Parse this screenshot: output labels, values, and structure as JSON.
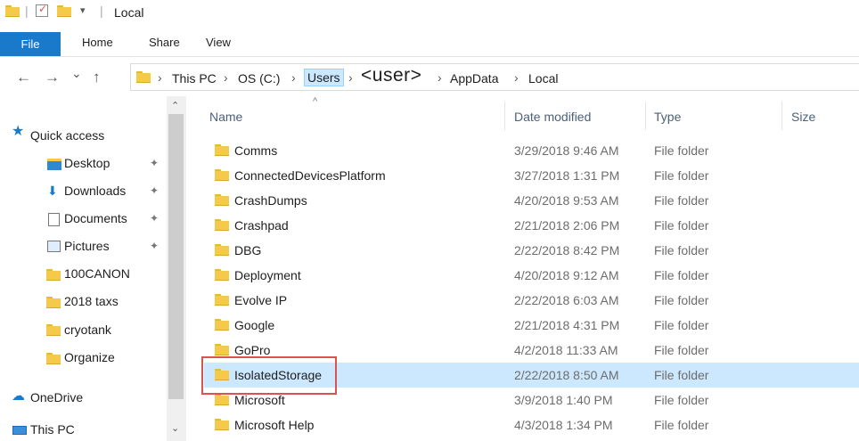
{
  "titlebar": {
    "title": "Local"
  },
  "ribbon": {
    "tabs": [
      "File",
      "Home",
      "Share",
      "View"
    ]
  },
  "nav": {
    "back": "←",
    "forward": "→",
    "recent": "⌄",
    "up": "↑"
  },
  "breadcrumb": [
    "This PC",
    "OS (C:)",
    "Users",
    "<user>",
    "AppData",
    "Local"
  ],
  "sidebar": {
    "items": [
      {
        "label": "Quick access"
      },
      {
        "label": "Desktop"
      },
      {
        "label": "Downloads"
      },
      {
        "label": "Documents"
      },
      {
        "label": "Pictures"
      },
      {
        "label": "100CANON"
      },
      {
        "label": "2018 taxs"
      },
      {
        "label": "cryotank"
      },
      {
        "label": "Organize"
      },
      {
        "label": "OneDrive"
      },
      {
        "label": "This PC"
      }
    ]
  },
  "columns": {
    "name": "Name",
    "date": "Date modified",
    "type": "Type",
    "size": "Size"
  },
  "rows": [
    {
      "name": "Comms",
      "date": "3/29/2018 9:46 AM",
      "type": "File folder"
    },
    {
      "name": "ConnectedDevicesPlatform",
      "date": "3/27/2018 1:31 PM",
      "type": "File folder"
    },
    {
      "name": "CrashDumps",
      "date": "4/20/2018 9:53 AM",
      "type": "File folder"
    },
    {
      "name": "Crashpad",
      "date": "2/21/2018 2:06 PM",
      "type": "File folder"
    },
    {
      "name": "DBG",
      "date": "2/22/2018 8:42 PM",
      "type": "File folder"
    },
    {
      "name": "Deployment",
      "date": "4/20/2018 9:12 AM",
      "type": "File folder"
    },
    {
      "name": "Evolve IP",
      "date": "2/22/2018 6:03 AM",
      "type": "File folder"
    },
    {
      "name": "Google",
      "date": "2/21/2018 4:31 PM",
      "type": "File folder"
    },
    {
      "name": "GoPro",
      "date": "4/2/2018 11:33 AM",
      "type": "File folder"
    },
    {
      "name": "IsolatedStorage",
      "date": "2/22/2018 8:50 AM",
      "type": "File folder"
    },
    {
      "name": "Microsoft",
      "date": "3/9/2018 1:40 PM",
      "type": "File folder"
    },
    {
      "name": "Microsoft Help",
      "date": "4/3/2018 1:34 PM",
      "type": "File folder"
    }
  ],
  "colors": {
    "accent": "#1979ca",
    "selection": "#cce8ff",
    "highlight": "#d9534f"
  }
}
